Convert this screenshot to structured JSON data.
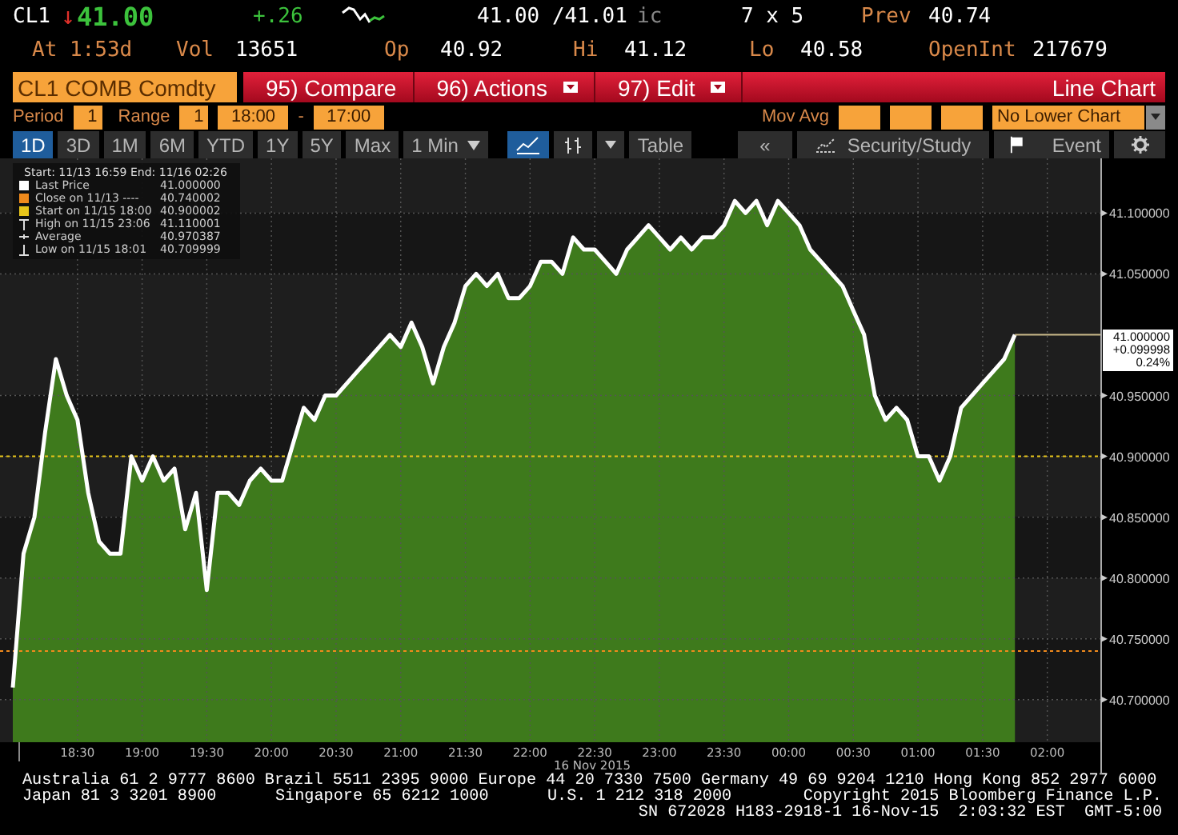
{
  "quote": {
    "symbol": "CL1",
    "arrow": "↓",
    "last": "41.00",
    "change": "+.26",
    "bid_ask": "41.00 /41.01",
    "condition": "ic",
    "size": "7 x 5",
    "prev_label": "Prev",
    "prev": "40.74"
  },
  "stats": [
    {
      "label": "At 1:53d"
    },
    {
      "label": "Vol",
      "value": "13651"
    },
    {
      "label": "Op",
      "value": "40.92"
    },
    {
      "label": "Hi",
      "value": "41.12"
    },
    {
      "label": "Lo",
      "value": "40.58"
    },
    {
      "label": "OpenInt",
      "value": "217679"
    }
  ],
  "security_field": {
    "value": "CL1 COMB Comdty"
  },
  "actions": [
    {
      "label": "95) Compare",
      "dropdown": false
    },
    {
      "label": "96) Actions",
      "dropdown": true
    },
    {
      "label": "97) Edit",
      "dropdown": true
    }
  ],
  "view_title": "Line Chart",
  "settings": {
    "period_label": "Period",
    "period": "1",
    "range_label": "Range",
    "range": "1",
    "start_time": "18:00",
    "separator": "-",
    "end_time": "17:00",
    "mov_avg_label": "Mov Avg",
    "lower_chart": "No Lower Chart"
  },
  "periods": [
    {
      "label": "1D",
      "selected": true
    },
    {
      "label": "3D",
      "selected": false
    },
    {
      "label": "1M",
      "selected": false
    },
    {
      "label": "6M",
      "selected": false
    },
    {
      "label": "YTD",
      "selected": false
    },
    {
      "label": "1Y",
      "selected": false
    },
    {
      "label": "5Y",
      "selected": false
    },
    {
      "label": "Max",
      "selected": false
    }
  ],
  "interval": "1 Min",
  "chart_types": [
    {
      "kind": "line",
      "selected": true
    },
    {
      "kind": "bars",
      "selected": false
    }
  ],
  "table_button": "Table",
  "right_tools": [
    {
      "kind": "back",
      "label": "«"
    },
    {
      "kind": "study",
      "label": "Security/Study"
    },
    {
      "kind": "event",
      "label": "Event"
    },
    {
      "kind": "settings"
    }
  ],
  "legend": {
    "header": "Start: 11/13 16:59 End: 11/16 02:26",
    "items": [
      {
        "kind": "swatch",
        "color": "#ffffff",
        "label": "Last Price",
        "value": "41.000000"
      },
      {
        "kind": "swatch",
        "color": "#f08a1c",
        "label": "Close on 11/13 ----",
        "value": "40.740002"
      },
      {
        "kind": "swatch",
        "color": "#e8c51a",
        "label": "Start on 11/15 18:00",
        "value": "40.900002"
      },
      {
        "kind": "high",
        "label": "High on 11/15 23:06",
        "value": "41.110001"
      },
      {
        "kind": "average",
        "label": "Average",
        "value": "40.970387"
      },
      {
        "kind": "low",
        "label": "Low on 11/15 18:01",
        "value": "40.709999"
      }
    ]
  },
  "last_price_tag": [
    "41.000000",
    "+0.099998",
    "0.24%"
  ],
  "chart": {
    "chart_data": {
      "type": "area",
      "xlabel": "16 Nov 2015",
      "categories": [
        null,
        null,
        null,
        null,
        null,
        null,
        "18:30",
        null,
        null,
        null,
        null,
        null,
        "19:00",
        null,
        null,
        null,
        null,
        null,
        "19:30",
        null,
        null,
        null,
        null,
        null,
        "20:00",
        null,
        null,
        null,
        null,
        null,
        "20:30",
        null,
        null,
        null,
        null,
        null,
        "21:00",
        null,
        null,
        null,
        null,
        null,
        "21:30",
        null,
        null,
        null,
        null,
        null,
        "22:00",
        null,
        null,
        null,
        null,
        null,
        "22:30",
        null,
        null,
        null,
        null,
        null,
        "23:00",
        null,
        null,
        null,
        null,
        null,
        "23:30",
        null,
        null,
        null,
        null,
        null,
        "00:00",
        null,
        null,
        null,
        null,
        null,
        "00:30",
        null,
        null,
        null,
        null,
        null,
        "01:00",
        null,
        null,
        null,
        null,
        null,
        "01:30",
        null,
        null,
        null,
        null,
        null,
        "02:00",
        null,
        null,
        null,
        null
      ],
      "series": [
        {
          "color": "#ffffff",
          "values": [
            40.71,
            40.82,
            40.85,
            40.92,
            40.98,
            40.95,
            40.93,
            40.87,
            40.83,
            40.82,
            40.82,
            40.9,
            40.88,
            40.9,
            40.88,
            40.89,
            40.84,
            40.87,
            40.79,
            40.87,
            40.87,
            40.86,
            40.88,
            40.89,
            40.88,
            40.88,
            40.91,
            40.94,
            40.93,
            40.95,
            40.95,
            40.96,
            40.97,
            40.98,
            40.99,
            41.0,
            40.99,
            41.01,
            40.99,
            40.96,
            40.99,
            41.01,
            41.04,
            41.05,
            41.04,
            41.05,
            41.03,
            41.03,
            41.04,
            41.06,
            41.06,
            41.05,
            41.08,
            41.07,
            41.07,
            41.06,
            41.05,
            41.07,
            41.08,
            41.09,
            41.08,
            41.07,
            41.08,
            41.07,
            41.08,
            41.08,
            41.09,
            41.11,
            41.1,
            41.11,
            41.09,
            41.11,
            41.1,
            41.09,
            41.07,
            41.06,
            41.05,
            41.04,
            41.02,
            41.0,
            40.95,
            40.93,
            40.94,
            40.93,
            40.9,
            40.9,
            40.88,
            40.9,
            40.94,
            40.95,
            40.96,
            40.97,
            40.98,
            41.0,
            null,
            null,
            null,
            null,
            null,
            null,
            null
          ]
        }
      ],
      "ylim": [
        40.665,
        41.145
      ],
      "yticks": [
        {
          "value": 41.1,
          "label": "41.100000"
        },
        {
          "value": 41.05,
          "label": "41.050000"
        },
        {
          "value": 40.95,
          "label": "40.950000"
        },
        {
          "value": 40.9,
          "label": "40.900000"
        },
        {
          "value": 40.85,
          "label": "40.850000"
        },
        {
          "value": 40.8,
          "label": "40.800000"
        },
        {
          "value": 40.75,
          "label": "40.750000"
        },
        {
          "value": 40.7,
          "label": "40.700000"
        }
      ],
      "grid": true,
      "ref_lines": [
        {
          "axis": "y",
          "value": 40.9,
          "color": "#e8c51a"
        },
        {
          "axis": "y",
          "value": 40.74,
          "color": "#f08a1c"
        }
      ]
    }
  },
  "footer": {
    "line_1": "Australia 61 2 9777 8600 Brazil 5511 2395 9000 Europe 44 20 7330 7500 Germany 49 69 9204 1210 Hong Kong 852 2977 6000",
    "line_2": [
      "Japan 81 3 3201 8900",
      "Singapore 65 6212 1000",
      "U.S. 1 212 318 2000",
      "Copyright 2015 Bloomberg Finance L.P."
    ],
    "line_3": "SN 672028 H183-2918-1 16-Nov-15  2:03:32 EST  GMT-5:00"
  }
}
